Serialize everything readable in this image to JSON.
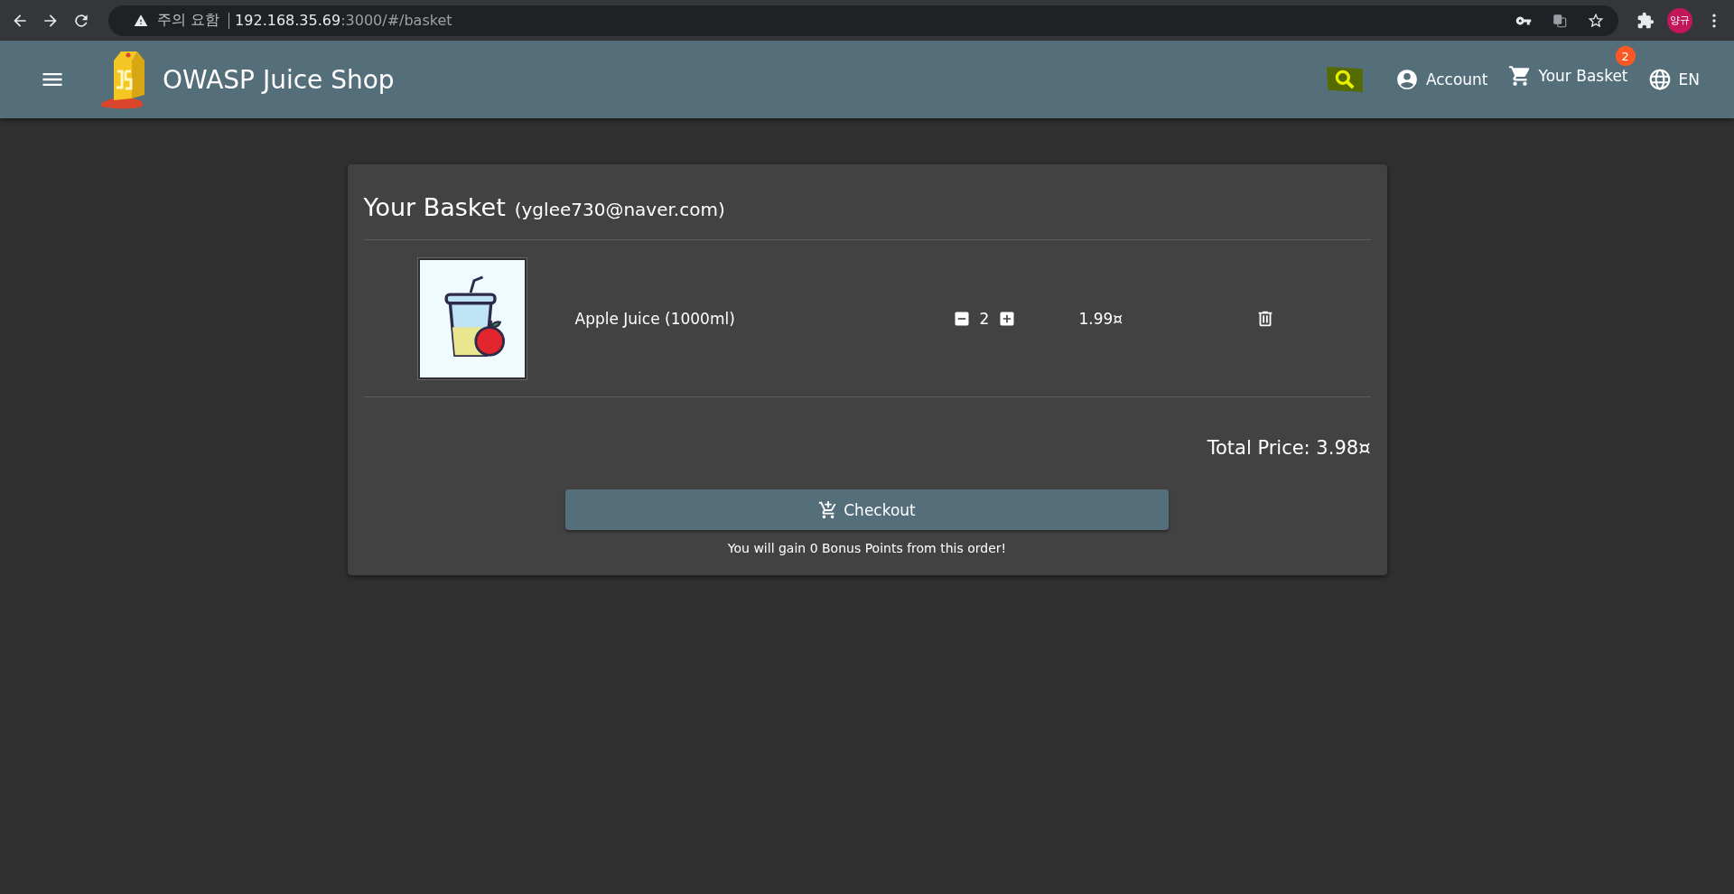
{
  "browser": {
    "security_label": "주의 요함",
    "url_host": "192.168.35.69",
    "url_path": ":3000/#/basket",
    "profile": "양규"
  },
  "header": {
    "title": "OWASP Juice Shop",
    "account": "Account",
    "basket": "Your Basket",
    "basket_count": "2",
    "language": "EN"
  },
  "basket": {
    "title": "Your Basket",
    "email": "(yglee730@naver.com)",
    "items": [
      {
        "name": "Apple Juice (1000ml)",
        "quantity": "2",
        "price": "1.99¤"
      }
    ],
    "total": "Total Price: 3.98¤",
    "checkout": "Checkout",
    "bonus": "You will gain 0 Bonus Points from this order!"
  }
}
